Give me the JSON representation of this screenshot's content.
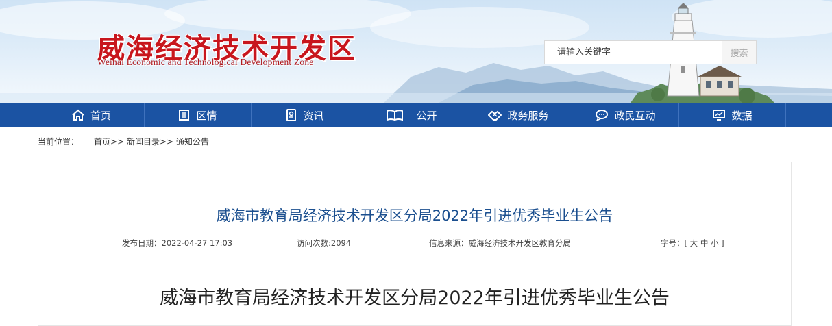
{
  "header": {
    "title": "威海经济技术开发区",
    "subtitle": "Weihai Economic and Technological Development Zone",
    "search_placeholder": "请输入关键字",
    "search_button": "搜索"
  },
  "nav": {
    "items": [
      {
        "label": "首页",
        "icon": "home-icon"
      },
      {
        "label": "区情",
        "icon": "book-icon"
      },
      {
        "label": "资讯",
        "icon": "news-icon"
      },
      {
        "label": "公开",
        "icon": "open-book-icon"
      },
      {
        "label": "政务服务",
        "icon": "handshake-icon"
      },
      {
        "label": "政民互动",
        "icon": "chat-icon"
      },
      {
        "label": "数据",
        "icon": "monitor-icon"
      }
    ]
  },
  "breadcrumb": {
    "label": "当前位置：",
    "items": [
      "首页>>",
      "新闻目录>>",
      "通知公告"
    ]
  },
  "article": {
    "title": "威海市教育局经济技术开发区分局2022年引进优秀毕业生公告",
    "meta": {
      "date": "发布日期：2022-04-27 17:03",
      "views": "访问次数:2094",
      "source": "信息来源：威海经济技术开发区教育分局",
      "font_label": "字号：[",
      "size_large": "大",
      "size_medium": "中",
      "size_small": "小",
      "font_end": "]"
    },
    "body_title": "威海市教育局经济技术开发区分局2022年引进优秀毕业生公告"
  },
  "colors": {
    "nav_bg": "#1b53a3",
    "title_red": "#c8161d",
    "article_title": "#1b4f8f"
  }
}
